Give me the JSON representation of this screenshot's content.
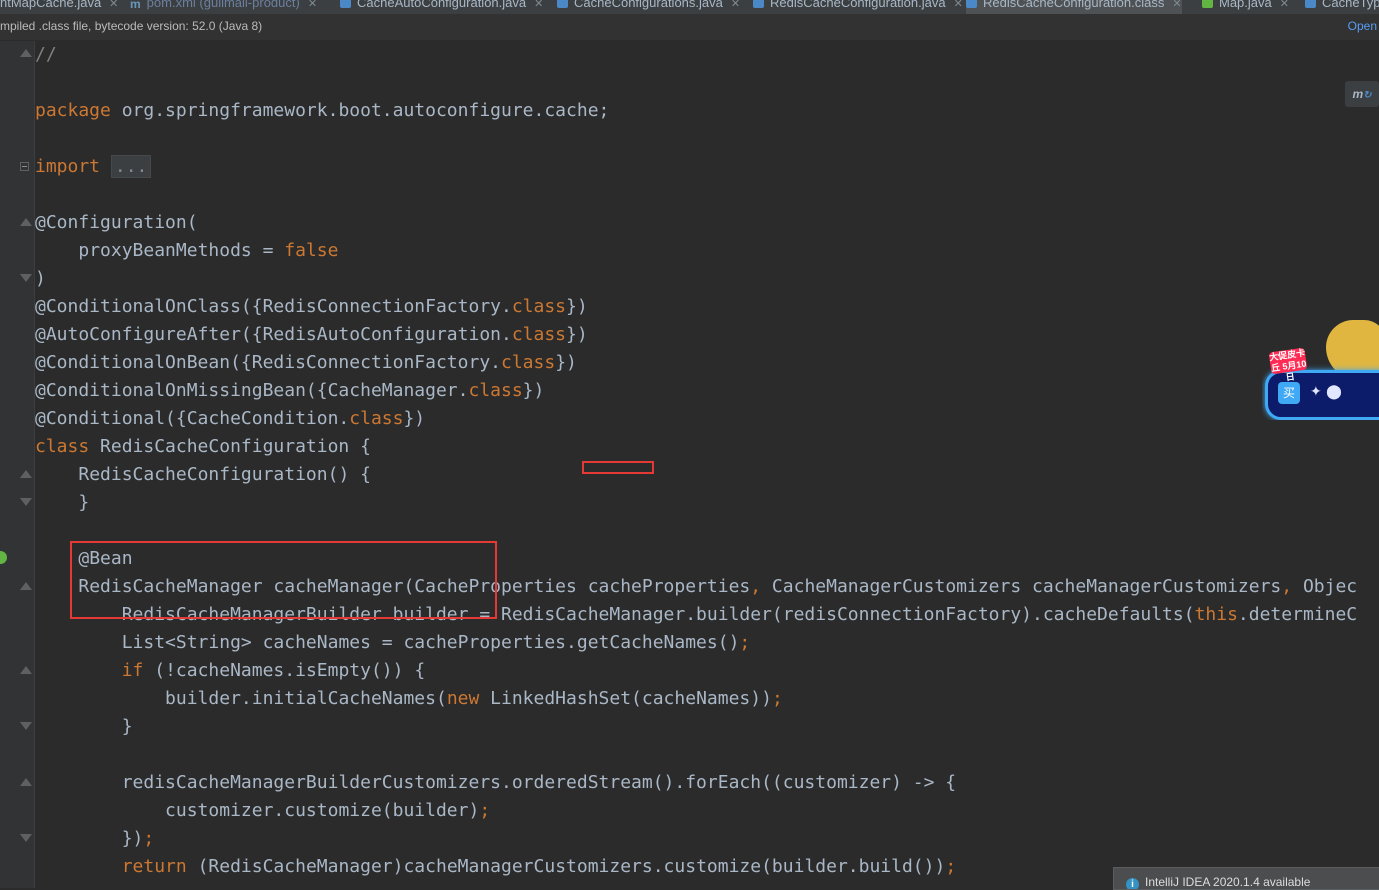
{
  "tabs": [
    {
      "label": "ntMapCache.java"
    },
    {
      "label": "pom.xml (gulimall-product)"
    },
    {
      "label": "CacheAutoConfiguration.java"
    },
    {
      "label": "CacheConfigurations.java"
    },
    {
      "label": "RedisCacheConfiguration.java"
    },
    {
      "label": "RedisCacheConfiguration.class"
    },
    {
      "label": "Map.java"
    },
    {
      "label": "CacheTyp"
    }
  ],
  "infobar": {
    "message": "mpiled .class file, bytecode version: 52.0 (Java 8)",
    "open_link": "Open"
  },
  "editor": {
    "comment": "//",
    "package_kw": "package",
    "package_name": "org.springframework.boot.autoconfigure.cache;",
    "import_kw": "import",
    "import_collapsed": "...",
    "configuration_annotation": "@Configuration(",
    "proxy_prop": "proxyBeanMethods = ",
    "proxy_val": "false",
    "close_paren": ")",
    "cond_on_class": "@ConditionalOnClass({RedisConnectionFactory.",
    "auto_after": "@AutoConfigureAfter({RedisAutoConfiguration.",
    "cond_on_bean": "@ConditionalOnBean({RedisConnectionFactory.",
    "cond_on_missing_bean": "@ConditionalOnMissingBean({CacheManager.",
    "conditional": "@Conditional({CacheCondition.",
    "class_kw": "class",
    "annotation_close": "})",
    "class_decl_kw": "class",
    "class_decl_rest": " RedisCacheConfiguration {",
    "ctor_line": "RedisCacheConfiguration() {",
    "close_brace": "}",
    "bean_annotation": "@Bean",
    "cache_manager_sig": "RedisCacheManager cacheManager(CacheProperties cacheProperties",
    "cache_manager_sig_comma1": ",",
    "cache_manager_sig_p2": " CacheManagerCustomizers cacheManagerCustomizers",
    "cache_manager_sig_comma2": ",",
    "cache_manager_sig_p3": " Objec",
    "builder_line_a": "RedisCacheManagerBuilder builder = RedisCacheManager.builder(redisConnectionFactory).cacheDefaults(",
    "builder_line_this": "this",
    "builder_line_b": ".determineC",
    "cache_names_line": "List<String> cacheNames = cacheProperties.getCacheNames()",
    "semicolon": ";",
    "if_kw": "if",
    "if_rest": " (!cacheNames.isEmpty()) {",
    "initial_a": "builder.initialCacheNames(",
    "new_kw": "new",
    "initial_b": " LinkedHashSet(cacheNames))",
    "customizers_line": "redisCacheManagerBuilderCustomizers.orderedStream().forEach((customizer) -> {",
    "customize_line": "customizer.customize(builder)",
    "lambda_close": "})",
    "return_kw": "return",
    "return_rest": " (RedisCacheManager)cacheManagerCustomizers.customize(builder.build())"
  },
  "maven_button": {
    "label": "m",
    "icon": "sync-icon"
  },
  "promo": {
    "badge": "大促皮卡丘 5月10日",
    "button": "买"
  },
  "notification": {
    "text": "IntelliJ IDEA 2020.1.4 available",
    "icon": "info-icon"
  },
  "colors": {
    "keyword": "#cc7832",
    "annotation": "#bbb529",
    "text": "#a9b7c6",
    "background": "#2b2b2b",
    "highlight": "#e53935"
  }
}
